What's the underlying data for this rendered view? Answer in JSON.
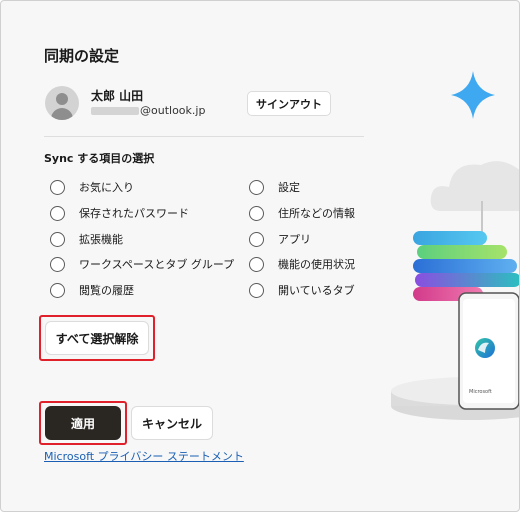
{
  "dialog": {
    "title": "同期の設定"
  },
  "account": {
    "name": "太郎 山田",
    "email_suffix": "@outlook.jp",
    "signout_label": "サインアウト"
  },
  "sync": {
    "section_label": "Sync する項目の選択",
    "left_options": [
      {
        "label": "お気に入り",
        "checked": false
      },
      {
        "label": "保存されたパスワード",
        "checked": false
      },
      {
        "label": "拡張機能",
        "checked": false
      },
      {
        "label": "ワークスペースとタブ グループ",
        "checked": false
      },
      {
        "label": "閲覧の履歴",
        "checked": false
      }
    ],
    "right_options": [
      {
        "label": "設定",
        "checked": false
      },
      {
        "label": "住所などの情報",
        "checked": false
      },
      {
        "label": "アプリ",
        "checked": false
      },
      {
        "label": "機能の使用状況",
        "checked": false
      },
      {
        "label": "開いているタブ",
        "checked": false
      }
    ],
    "deselect_all_label": "すべて選択解除"
  },
  "footer": {
    "apply_label": "適用",
    "cancel_label": "キャンセル",
    "privacy_link": "Microsoft プライバシー ステートメント"
  },
  "illustration": {
    "phone_caption": "Microsoft",
    "icons": [
      "sparkle-icon",
      "cloud-icon",
      "edge-logo-icon"
    ]
  },
  "colors": {
    "highlight_outline": "#e0202a",
    "primary_button": "#2a2622",
    "link": "#1a5fb4",
    "sparkle": "#3ea8f0"
  }
}
